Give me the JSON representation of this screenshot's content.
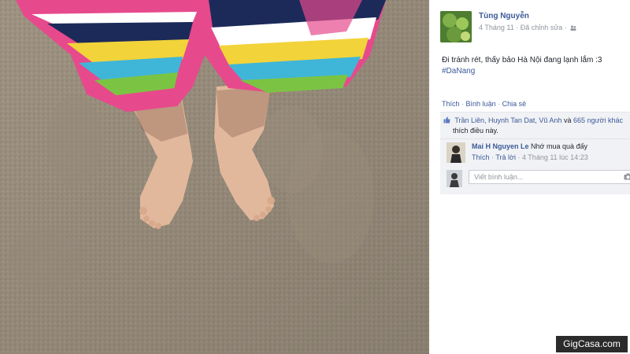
{
  "post": {
    "author": "Tùng Nguyễn",
    "date": "4 Tháng 11",
    "edited": "Đã chỉnh sửa",
    "text": "Đi tránh rét, thấy bảo Hà Nội đang lạnh lắm :3",
    "hashtag": "#DaNang",
    "privacy_icon": "friends-icon"
  },
  "actions": {
    "like": "Thích",
    "comment": "Bình luận",
    "share": "Chia sẻ",
    "separator": "·"
  },
  "likes": {
    "icon": "thumbs-up-icon",
    "names": "Trần Liên, Huynh Tan Dat, Vũ Anh",
    "connector": "và",
    "others": "665 người khác",
    "suffix": "thích điều này."
  },
  "comment": {
    "author": "Mai H Nguyen Le",
    "text": "Nhớ mua quà đấy",
    "like": "Thích",
    "reply": "Trả lời",
    "time": "4 Tháng 11 lúc 14:23"
  },
  "reply_box": {
    "placeholder": "Viết bình luận...",
    "camera_icon": "camera-icon"
  },
  "watermark": "GigCasa.com"
}
